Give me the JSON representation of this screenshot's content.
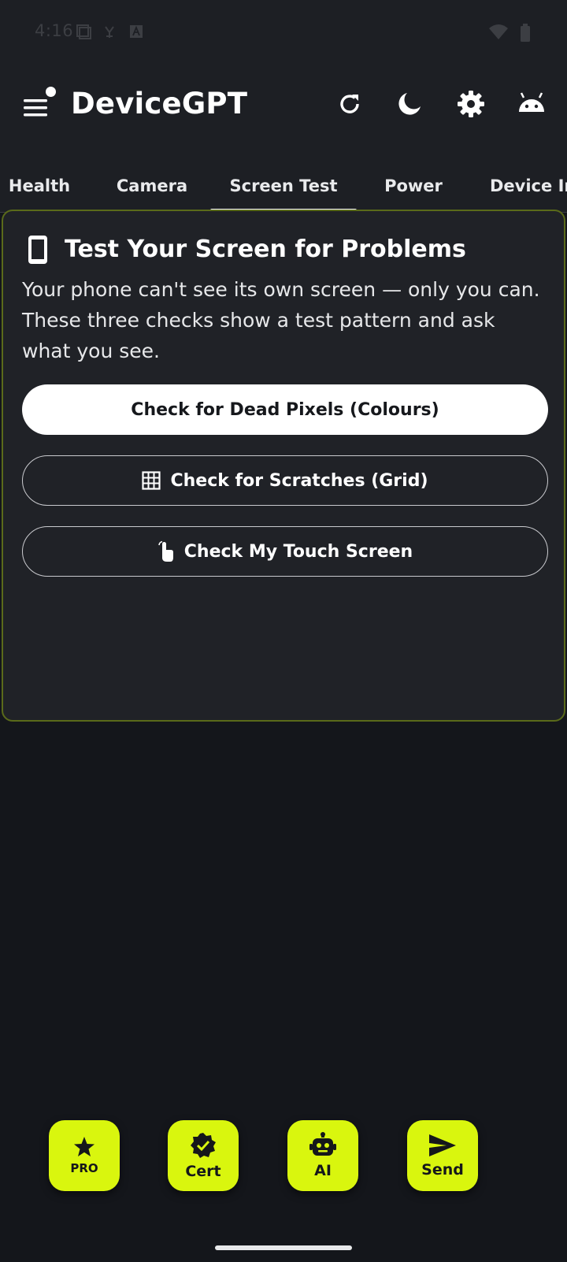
{
  "status_bar": {
    "time": "4:16",
    "icons": [
      "screenshot-icon",
      "usb-debug-icon",
      "font-icon",
      "wifi-icon",
      "battery-icon"
    ]
  },
  "app_bar": {
    "title": "DeviceGPT",
    "actions": [
      "refresh-icon",
      "dark-mode-icon",
      "settings-icon",
      "android-icon"
    ]
  },
  "tabs": {
    "items": [
      {
        "label": "Health"
      },
      {
        "label": "Camera"
      },
      {
        "label": "Screen Test"
      },
      {
        "label": "Power"
      },
      {
        "label": "Device In"
      }
    ],
    "selected": "Screen Test"
  },
  "card": {
    "title": "Test Your Screen for Problems",
    "description": "Your phone can't see its own screen — only you can. These three checks show a test pattern and ask what you see.",
    "buttons": {
      "dead_pixels": "Check for Dead Pixels (Colours)",
      "scratches": "Check for Scratches (Grid)",
      "touch": "Check My Touch Screen"
    }
  },
  "fabs": [
    {
      "label": "PRO",
      "icon": "star-icon"
    },
    {
      "label": "Cert",
      "icon": "verified-badge-icon"
    },
    {
      "label": "AI",
      "icon": "robot-icon"
    },
    {
      "label": "Send",
      "icon": "send-icon"
    }
  ],
  "colors": {
    "accent": "#d9f60e",
    "background": "#14161b",
    "surface": "#1d1f24",
    "card_border": "#5a6a1a"
  }
}
